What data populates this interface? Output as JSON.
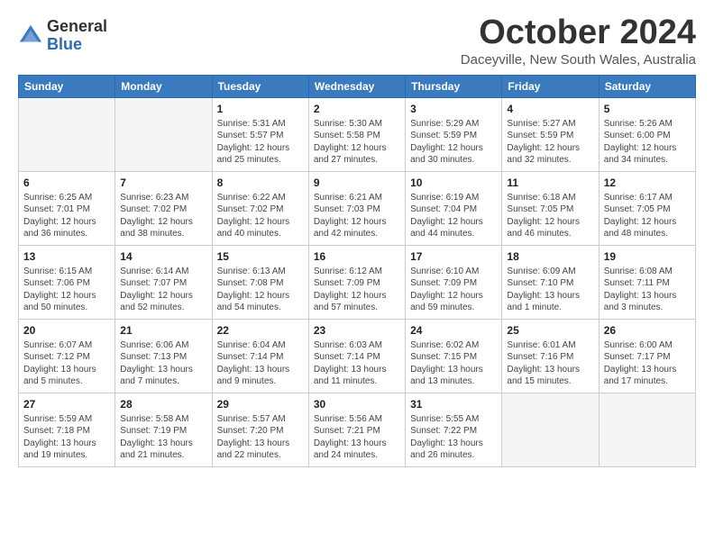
{
  "logo": {
    "general": "General",
    "blue": "Blue"
  },
  "title": "October 2024",
  "location": "Daceyville, New South Wales, Australia",
  "days_of_week": [
    "Sunday",
    "Monday",
    "Tuesday",
    "Wednesday",
    "Thursday",
    "Friday",
    "Saturday"
  ],
  "weeks": [
    [
      {
        "day": "",
        "info": ""
      },
      {
        "day": "",
        "info": ""
      },
      {
        "day": "1",
        "info": "Sunrise: 5:31 AM\nSunset: 5:57 PM\nDaylight: 12 hours\nand 25 minutes."
      },
      {
        "day": "2",
        "info": "Sunrise: 5:30 AM\nSunset: 5:58 PM\nDaylight: 12 hours\nand 27 minutes."
      },
      {
        "day": "3",
        "info": "Sunrise: 5:29 AM\nSunset: 5:59 PM\nDaylight: 12 hours\nand 30 minutes."
      },
      {
        "day": "4",
        "info": "Sunrise: 5:27 AM\nSunset: 5:59 PM\nDaylight: 12 hours\nand 32 minutes."
      },
      {
        "day": "5",
        "info": "Sunrise: 5:26 AM\nSunset: 6:00 PM\nDaylight: 12 hours\nand 34 minutes."
      }
    ],
    [
      {
        "day": "6",
        "info": "Sunrise: 6:25 AM\nSunset: 7:01 PM\nDaylight: 12 hours\nand 36 minutes."
      },
      {
        "day": "7",
        "info": "Sunrise: 6:23 AM\nSunset: 7:02 PM\nDaylight: 12 hours\nand 38 minutes."
      },
      {
        "day": "8",
        "info": "Sunrise: 6:22 AM\nSunset: 7:02 PM\nDaylight: 12 hours\nand 40 minutes."
      },
      {
        "day": "9",
        "info": "Sunrise: 6:21 AM\nSunset: 7:03 PM\nDaylight: 12 hours\nand 42 minutes."
      },
      {
        "day": "10",
        "info": "Sunrise: 6:19 AM\nSunset: 7:04 PM\nDaylight: 12 hours\nand 44 minutes."
      },
      {
        "day": "11",
        "info": "Sunrise: 6:18 AM\nSunset: 7:05 PM\nDaylight: 12 hours\nand 46 minutes."
      },
      {
        "day": "12",
        "info": "Sunrise: 6:17 AM\nSunset: 7:05 PM\nDaylight: 12 hours\nand 48 minutes."
      }
    ],
    [
      {
        "day": "13",
        "info": "Sunrise: 6:15 AM\nSunset: 7:06 PM\nDaylight: 12 hours\nand 50 minutes."
      },
      {
        "day": "14",
        "info": "Sunrise: 6:14 AM\nSunset: 7:07 PM\nDaylight: 12 hours\nand 52 minutes."
      },
      {
        "day": "15",
        "info": "Sunrise: 6:13 AM\nSunset: 7:08 PM\nDaylight: 12 hours\nand 54 minutes."
      },
      {
        "day": "16",
        "info": "Sunrise: 6:12 AM\nSunset: 7:09 PM\nDaylight: 12 hours\nand 57 minutes."
      },
      {
        "day": "17",
        "info": "Sunrise: 6:10 AM\nSunset: 7:09 PM\nDaylight: 12 hours\nand 59 minutes."
      },
      {
        "day": "18",
        "info": "Sunrise: 6:09 AM\nSunset: 7:10 PM\nDaylight: 13 hours\nand 1 minute."
      },
      {
        "day": "19",
        "info": "Sunrise: 6:08 AM\nSunset: 7:11 PM\nDaylight: 13 hours\nand 3 minutes."
      }
    ],
    [
      {
        "day": "20",
        "info": "Sunrise: 6:07 AM\nSunset: 7:12 PM\nDaylight: 13 hours\nand 5 minutes."
      },
      {
        "day": "21",
        "info": "Sunrise: 6:06 AM\nSunset: 7:13 PM\nDaylight: 13 hours\nand 7 minutes."
      },
      {
        "day": "22",
        "info": "Sunrise: 6:04 AM\nSunset: 7:14 PM\nDaylight: 13 hours\nand 9 minutes."
      },
      {
        "day": "23",
        "info": "Sunrise: 6:03 AM\nSunset: 7:14 PM\nDaylight: 13 hours\nand 11 minutes."
      },
      {
        "day": "24",
        "info": "Sunrise: 6:02 AM\nSunset: 7:15 PM\nDaylight: 13 hours\nand 13 minutes."
      },
      {
        "day": "25",
        "info": "Sunrise: 6:01 AM\nSunset: 7:16 PM\nDaylight: 13 hours\nand 15 minutes."
      },
      {
        "day": "26",
        "info": "Sunrise: 6:00 AM\nSunset: 7:17 PM\nDaylight: 13 hours\nand 17 minutes."
      }
    ],
    [
      {
        "day": "27",
        "info": "Sunrise: 5:59 AM\nSunset: 7:18 PM\nDaylight: 13 hours\nand 19 minutes."
      },
      {
        "day": "28",
        "info": "Sunrise: 5:58 AM\nSunset: 7:19 PM\nDaylight: 13 hours\nand 21 minutes."
      },
      {
        "day": "29",
        "info": "Sunrise: 5:57 AM\nSunset: 7:20 PM\nDaylight: 13 hours\nand 22 minutes."
      },
      {
        "day": "30",
        "info": "Sunrise: 5:56 AM\nSunset: 7:21 PM\nDaylight: 13 hours\nand 24 minutes."
      },
      {
        "day": "31",
        "info": "Sunrise: 5:55 AM\nSunset: 7:22 PM\nDaylight: 13 hours\nand 26 minutes."
      },
      {
        "day": "",
        "info": ""
      },
      {
        "day": "",
        "info": ""
      }
    ]
  ]
}
